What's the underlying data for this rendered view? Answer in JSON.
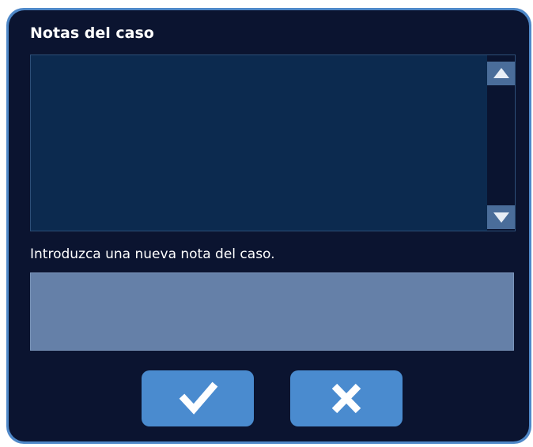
{
  "dialog": {
    "title": "Notas del caso",
    "notes_text": "",
    "new_note_prompt": "Introduzca una nueva nota del caso.",
    "new_note_value": "",
    "confirm_icon": "checkmark-icon",
    "cancel_icon": "x-icon",
    "scroll_up_icon": "arrow-up-icon",
    "scroll_down_icon": "arrow-down-icon"
  },
  "colors": {
    "dialog_background": "#0b1430",
    "frame_border": "#4f88c8",
    "notes_background": "#0c2a4f",
    "input_background": "#6580a8",
    "button_background": "#4a8bcf",
    "text": "#ffffff"
  }
}
